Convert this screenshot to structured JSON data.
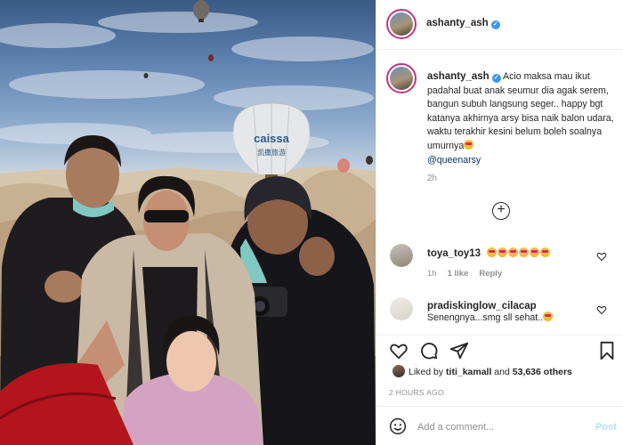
{
  "post": {
    "image_alt": "family photo with hot air balloons",
    "balloon_text": "caissa",
    "balloon_subtext": "凯撒旅游"
  },
  "header": {
    "username": "ashanty_ash",
    "verified": true
  },
  "caption": {
    "username": "ashanty_ash",
    "text": "Acio maksa mau ikut padahal buat anak seumur dia agak serem, bangun subuh langsung seger.. happy bgt katanya akhirnya arsy bisa naik balon udara, waktu terakhir kesini belum boleh soalnya umurnya",
    "mention": "@queenarsy",
    "time": "2h"
  },
  "comments": [
    {
      "username": "toya_toy13",
      "text": "",
      "emoji_count": 6,
      "time": "1h",
      "likes": "1 like",
      "reply": "Reply"
    },
    {
      "username": "pradiskinglow_cilacap",
      "text": "Senengnya...smg sll sehat..",
      "emoji_count": 1
    }
  ],
  "likes": {
    "prefix": "Liked by ",
    "user": "titi_kamall",
    "middle": " and ",
    "count": "53,636 others"
  },
  "time_ago": "2 HOURS AGO",
  "add_comment": {
    "placeholder": "Add a comment...",
    "post_label": "Post"
  },
  "colors": {
    "verified": "#3897f0",
    "story_ring": "#c13584",
    "post_disabled": "#b2dffc",
    "mention": "#00376b"
  }
}
